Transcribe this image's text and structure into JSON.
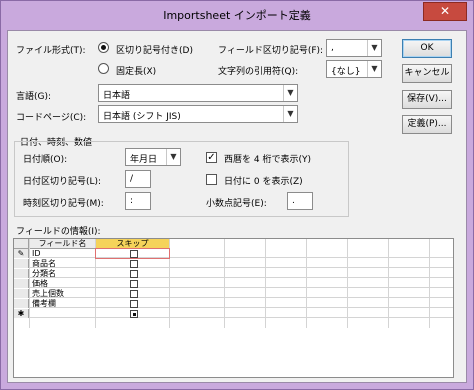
{
  "window": {
    "title": "Importsheet インポート定義",
    "close_label": "✕"
  },
  "format": {
    "label": "ファイル形式(T):",
    "options": [
      "区切り記号付き(D)",
      "固定長(X)"
    ]
  },
  "field_delim": {
    "label": "フィールド区切り記号(F):",
    "value": ","
  },
  "text_qualifier": {
    "label": "文字列の引用符(Q):",
    "value": "{なし}"
  },
  "language": {
    "label": "言語(G):",
    "value": "日本語"
  },
  "codepage": {
    "label": "コードページ(C):",
    "value": "日本語 (シフト JIS)"
  },
  "buttons": {
    "ok": "OK",
    "cancel": "キャンセル",
    "save": "保存(V)...",
    "specs": "定義(P)..."
  },
  "datetime": {
    "legend": "日付、時刻、数値",
    "date_order_label": "日付順(O):",
    "date_order": "年月日",
    "date_delim_label": "日付区切り記号(L):",
    "date_delim": "/",
    "time_delim_label": "時刻区切り記号(M):",
    "time_delim": ":",
    "four_digit_label": "西暦を 4 桁で表示(Y)",
    "leading_zero_label": "日付に 0 を表示(Z)",
    "decimal_label": "小数点記号(E):",
    "decimal": "."
  },
  "fields": {
    "label": "フィールドの情報(I):",
    "columns": [
      "フィールド名",
      "スキップ"
    ],
    "rows": [
      "ID",
      "商品名",
      "分類名",
      "価格",
      "売上個数",
      "備考欄"
    ]
  }
}
